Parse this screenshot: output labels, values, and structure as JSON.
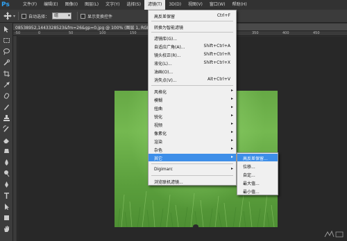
{
  "app": {
    "logo": "Ps"
  },
  "menubar": {
    "items": [
      {
        "label": "文件(F)",
        "active": false
      },
      {
        "label": "编辑(E)",
        "active": false
      },
      {
        "label": "图像(I)",
        "active": false
      },
      {
        "label": "图层(L)",
        "active": false
      },
      {
        "label": "文字(Y)",
        "active": false
      },
      {
        "label": "选择(S)",
        "active": false
      },
      {
        "label": "滤镜(T)",
        "active": true
      },
      {
        "label": "3D(D)",
        "active": false
      },
      {
        "label": "视图(V)",
        "active": false
      },
      {
        "label": "窗口(W)",
        "active": false
      },
      {
        "label": "帮助(H)",
        "active": false
      }
    ]
  },
  "options_bar": {
    "auto_select_label": "自动选择：",
    "auto_select_value": "组",
    "show_transform_label": "显示变换控件"
  },
  "document": {
    "tab_title": "08538952,1443328523&fm=26&gp=0.jpg @ 100% (图层 1, RGB/8)"
  },
  "ruler": {
    "ticks": [
      "-50",
      "0",
      "50",
      "100",
      "150",
      "200",
      "250",
      "300",
      "350",
      "400",
      "450"
    ]
  },
  "filter_menu": {
    "items": [
      {
        "label": "高反差保留",
        "shortcut": "Ctrl+F",
        "submenu": false
      },
      {
        "label": "转换为智能滤镜",
        "shortcut": "",
        "submenu": false
      },
      {
        "label": "滤镜库(G)...",
        "shortcut": "",
        "submenu": false
      },
      {
        "label": "自适应广角(A)...",
        "shortcut": "Shift+Ctrl+A",
        "submenu": false
      },
      {
        "label": "镜头校正(R)...",
        "shortcut": "Shift+Ctrl+R",
        "submenu": false
      },
      {
        "label": "液化(L)...",
        "shortcut": "Shift+Ctrl+X",
        "submenu": false
      },
      {
        "label": "油画(O)...",
        "shortcut": "",
        "submenu": false
      },
      {
        "label": "消失点(V)...",
        "shortcut": "Alt+Ctrl+V",
        "submenu": false
      },
      {
        "label": "风格化",
        "shortcut": "",
        "submenu": true
      },
      {
        "label": "模糊",
        "shortcut": "",
        "submenu": true
      },
      {
        "label": "扭曲",
        "shortcut": "",
        "submenu": true
      },
      {
        "label": "锐化",
        "shortcut": "",
        "submenu": true
      },
      {
        "label": "视频",
        "shortcut": "",
        "submenu": true
      },
      {
        "label": "像素化",
        "shortcut": "",
        "submenu": true
      },
      {
        "label": "渲染",
        "shortcut": "",
        "submenu": true
      },
      {
        "label": "杂色",
        "shortcut": "",
        "submenu": true
      },
      {
        "label": "其它",
        "shortcut": "",
        "submenu": true,
        "highlighted": true
      },
      {
        "label": "Digimarc",
        "shortcut": "",
        "submenu": true
      },
      {
        "label": "浏览联机滤镜...",
        "shortcut": "",
        "submenu": false
      }
    ]
  },
  "other_submenu": {
    "items": [
      {
        "label": "高反差保留...",
        "highlighted": true
      },
      {
        "label": "位移..."
      },
      {
        "label": "自定..."
      },
      {
        "label": "最大值..."
      },
      {
        "label": "最小值..."
      }
    ]
  },
  "colors": {
    "highlight": "#3d8ee8",
    "menu_bg": "#f0f0f0",
    "app_bg": "#2f2f2f",
    "ps_blue": "#2fa3f5"
  }
}
